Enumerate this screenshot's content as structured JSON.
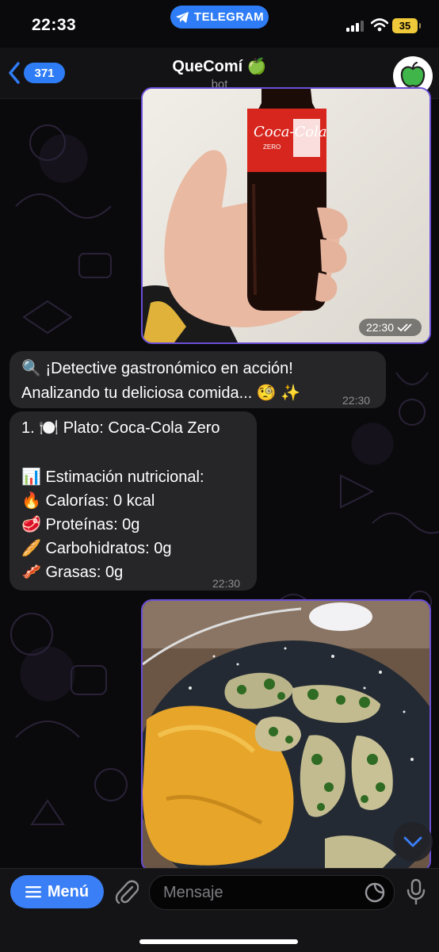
{
  "status_bar": {
    "time": "22:33",
    "app_pill": "TELEGRAM",
    "battery": "35"
  },
  "header": {
    "back_count": "371",
    "title": "QueComí 🍏",
    "subtitle": "bot"
  },
  "messages": [
    {
      "type": "photo",
      "time": "22:30",
      "status": "read-checkmarks"
    },
    {
      "type": "text",
      "lines": [
        "🔍 ¡Detective gastronómico en acción!",
        "Analizando tu deliciosa comida... 🧐 ✨"
      ],
      "time": "22:30"
    },
    {
      "type": "text",
      "lines": [
        "1. 🍽️ Plato: Coca-Cola Zero",
        "",
        "📊 Estimación nutricional:",
        "🔥 Calorías: 0 kcal",
        "🥩 Proteínas: 0g",
        "🥖 Carbohidratos: 0g",
        "🥓 Grasas: 0g"
      ],
      "time": "22:30"
    },
    {
      "type": "photo"
    }
  ],
  "input_bar": {
    "menu_label": "Menú",
    "placeholder": "Mensaje"
  },
  "icons": [
    "back-chevron-icon",
    "telegram-plane-icon",
    "signal-icon",
    "wifi-icon",
    "apple-icon",
    "read-checkmarks-icon",
    "chevron-down-icon",
    "hamburger-icon",
    "paperclip-icon",
    "sticker-icon",
    "microphone-icon"
  ],
  "colors": {
    "accent": "#2f7df6",
    "outgoing_border": "#6b4fd8",
    "incoming_bubble": "#262628",
    "battery": "#f0c93a"
  }
}
